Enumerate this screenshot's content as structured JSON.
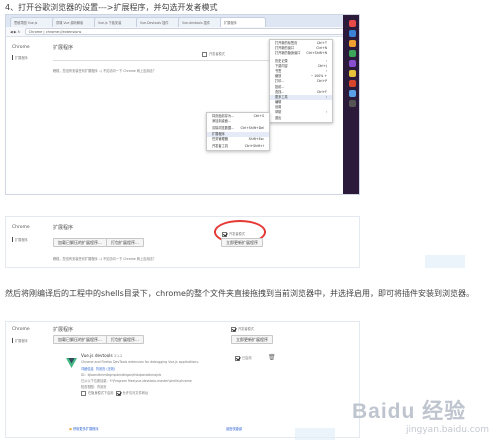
{
  "captions": {
    "step4": "4、打开谷歌浏览器的设置--->扩展程序，并勾选开发者模式",
    "step5": "然后将刚编译后的工程中的shells目录下，chrome的整个文件夹直接拖拽到当前浏览器中，并选择启用，即可将插件安装到浏览器。"
  },
  "shot1": {
    "tabs": [
      "思维导图 Vue.js",
      "慕课 Vue 源码解读",
      "Vue.js 下载安装",
      "Vue-Devtools 插件",
      "Vue-devtools 插件",
      "扩展程序"
    ],
    "url": "Chrome | chrome://extensions",
    "brand": "Chrome",
    "sidebar_item": "扩展程序",
    "title": "扩展程序",
    "dev_mode": "开发者模式",
    "empty_text": "糟糕，您没有安装任何扩展程序 :-(   不如访问一下 Chrome 网上应用店？",
    "menu_main": [
      "打开新的标签页",
      "打开新的窗口",
      "打开新的隐身窗口",
      "历史记录",
      "下载内容",
      "书签",
      "缩放",
      "打印...",
      "投射...",
      "查找...",
      "更多工具",
      "编辑",
      "设置",
      "帮助",
      "退出"
    ],
    "menu_main_short": [
      "Ctrl+T",
      "Ctrl+N",
      "Ctrl+Shift+N",
      "",
      "Ctrl+J",
      "",
      "",
      "Ctrl+P",
      "",
      "Ctrl+F",
      "",
      "",
      "",
      "",
      ""
    ],
    "zoom": "100%",
    "menu_sub": [
      "将页面另存为...",
      "添加到桌面...",
      "清除浏览数据...",
      "扩展程序",
      "任务管理器",
      "开发者工具"
    ],
    "menu_sub_short": [
      "Ctrl+S",
      "",
      "Ctrl+Shift+Del",
      "",
      "Shift+Esc",
      "Ctrl+Shift+I"
    ]
  },
  "shot2": {
    "brand": "Chrome",
    "title": "扩展程序",
    "sidebar_item": "扩展程序",
    "dev_mode": "开发者模式",
    "btn_load": "加载已解压的扩展程序...",
    "btn_pack": "打包扩展程序...",
    "btn_update": "立即更新扩展程序",
    "empty_text": "糟糕，您没有安装任何扩展程序 :-(   不如访问一下 Chrome 网上应用店？"
  },
  "shot3": {
    "brand": "Chrome",
    "title": "扩展程序",
    "sidebar_item": "扩展程序",
    "dev_mode": "开发者模式",
    "btn_load": "加载已解压的扩展程序...",
    "btn_pack": "打包扩展程序...",
    "btn_update": "立即更新扩展程序",
    "ext_name": "Vue.js devtools",
    "ext_version": "3.1.2",
    "ext_desc": "Chrome and Firefox DevTools extension for debugging Vue.js applications.",
    "ext_details": "详细信息",
    "ext_bg": "背景页 (无效)",
    "ext_id": "ID：kjbomdlmmlbgmpbmlbhganjfnkdpenblkmajnb",
    "ext_path": "已从以下位置加载：F:\\Program files\\vue-devtools-master\\shells\\chrome",
    "ext_inspect": "检查视图：背景页",
    "ext_enabled": "已启用",
    "ext_incog": "在隐身模式下启用",
    "ext_fileurl": "允许访问文件网址",
    "more": "获取更多扩展程序",
    "shortcuts": "键盘快捷键"
  },
  "watermark": "Baidu 经验",
  "watermark_url": "jingyan.baidu.com"
}
